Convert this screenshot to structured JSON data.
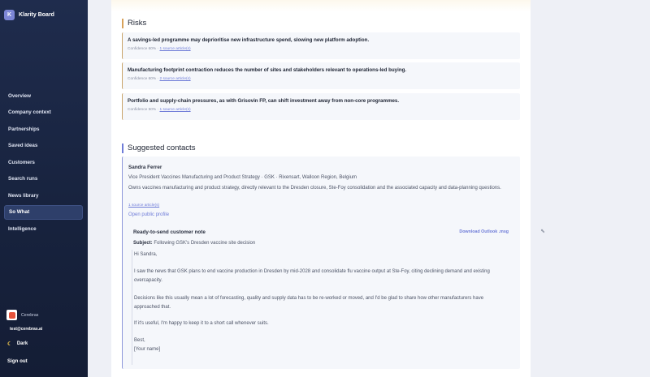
{
  "app": {
    "name": "Klarity Board",
    "logo_letter": "K"
  },
  "sidebar": {
    "items": [
      {
        "label": "Overview"
      },
      {
        "label": "Company context"
      },
      {
        "label": "Partnerships"
      },
      {
        "label": "Saved ideas"
      },
      {
        "label": "Customers"
      },
      {
        "label": "Search runs"
      },
      {
        "label": "News library"
      },
      {
        "label": "So What",
        "active": true
      },
      {
        "label": "Intelligence"
      }
    ],
    "org_name": "Cerebras",
    "email": "test@cerebras.ai",
    "theme_label": "Dark",
    "theme_icon": "☾",
    "signout_label": "Sign out"
  },
  "risks": {
    "title": "Risks",
    "items": [
      {
        "title": "A savings-led programme may deprioritise new infrastructure spend, slowing new platform adoption.",
        "confidence": "Confidence 60% · ",
        "sources": "1 source article(s)"
      },
      {
        "title": "Manufacturing footprint contraction reduces the number of sites and stakeholders relevant to operations-led buying.",
        "confidence": "Confidence 60% · ",
        "sources": "2 source article(s)"
      },
      {
        "title": "Portfolio and supply-chain pressures, as with Grisovin FP, can shift investment away from non-core programmes.",
        "confidence": "Confidence 50% · ",
        "sources": "1 source article(s)"
      }
    ]
  },
  "contacts": {
    "title": "Suggested contacts",
    "name": "Sandra Ferrer",
    "role": "Vice President Vaccines Manufacturing and Product Strategy · GSK · Rixensart, Walloon Region, Belgium",
    "description": "Owns vaccines manufacturing and product strategy, directly relevant to the Dresden closure, Ste-Foy consolidation and the associated capacity and data-planning questions.",
    "sources": "1 source article(s)",
    "profile_link": "Open public profile",
    "note": {
      "heading": "Ready-to-send customer note",
      "download": "Download Outlook .msg",
      "subject_label": "Subject:",
      "subject": "Following GSK's Dresden vaccine site decision",
      "greeting": "Hi Sandra,",
      "p1": "I saw the news that GSK plans to end vaccine production in Dresden by mid-2028 and consolidate flu vaccine output at Ste-Foy, citing declining demand and existing overcapacity.",
      "p2": "Decisions like this usually mean a lot of forecasting, quality and supply data has to be re-worked or moved, and I'd be glad to share how other manufacturers have approached that.",
      "p3": "If it's useful, I'm happy to keep it to a short call whenever suits.",
      "signoff": "Best,",
      "signature": "[Your name]"
    }
  },
  "colors": {
    "accent": "#6f7cd8",
    "risk_border": "#c9a46a",
    "sidebar_bg": "#1f2c4d"
  }
}
